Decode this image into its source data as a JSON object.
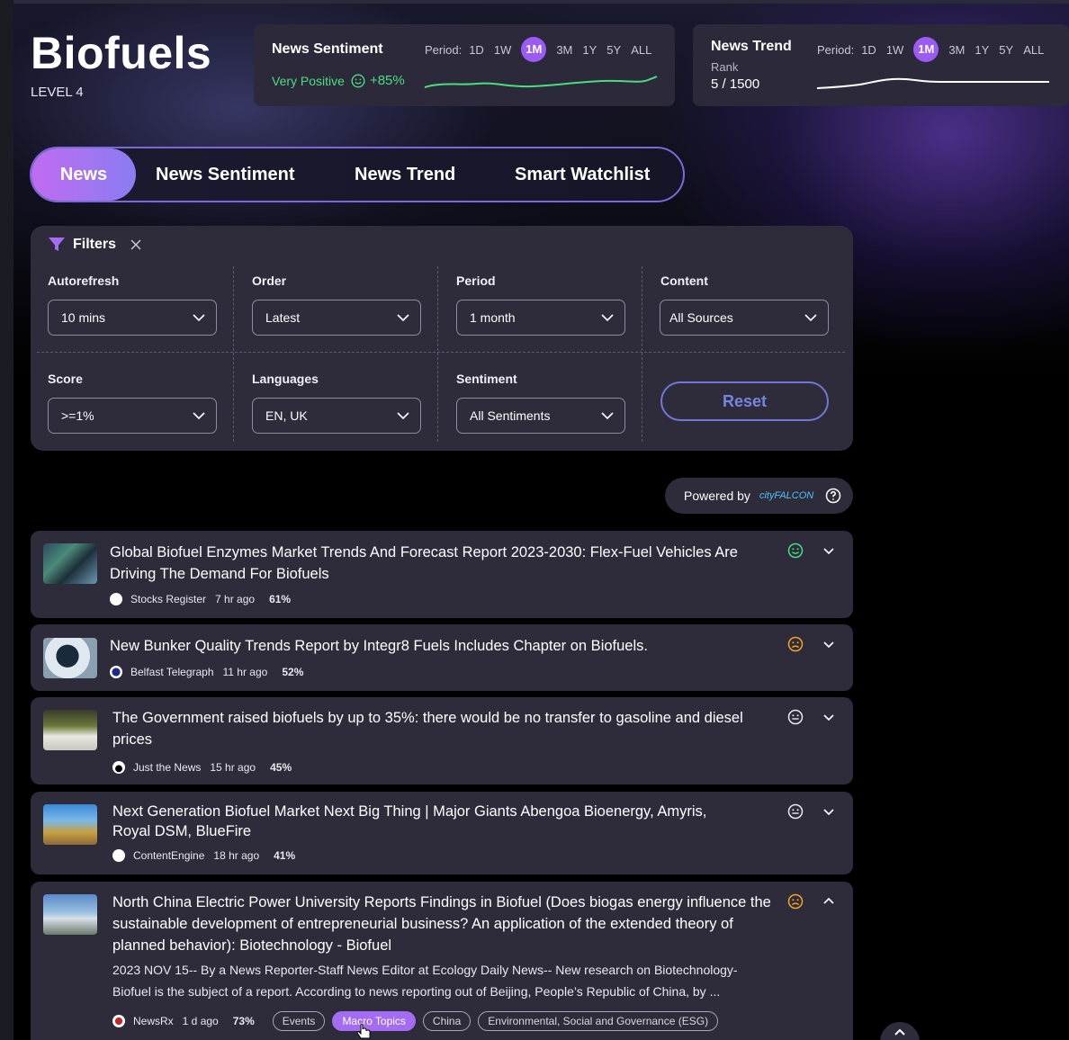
{
  "header": {
    "title": "Biofuels",
    "level": "LEVEL 4"
  },
  "sentiment_card": {
    "title": "News Sentiment",
    "status": "Very Positive",
    "value": "+85%",
    "period_label": "Period:",
    "periods": [
      "1D",
      "1W",
      "1M",
      "3M",
      "1Y",
      "5Y",
      "ALL"
    ],
    "active_period": "1M",
    "line_color": "#4ade80"
  },
  "trend_card": {
    "title": "News Trend",
    "rank_label": "Rank",
    "rank_value": "5 / 1500",
    "period_label": "Period:",
    "periods": [
      "1D",
      "1W",
      "1M",
      "3M",
      "1Y",
      "5Y",
      "ALL"
    ],
    "active_period": "1M"
  },
  "tabs": {
    "items": [
      "News",
      "News Sentiment",
      "News Trend",
      "Smart Watchlist"
    ],
    "active": "News"
  },
  "filters": {
    "title": "Filters",
    "autorefresh": {
      "label": "Autorefresh",
      "value": "10 mins"
    },
    "order": {
      "label": "Order",
      "value": "Latest"
    },
    "period": {
      "label": "Period",
      "value": "1 month"
    },
    "content": {
      "label": "Content",
      "value": "All Sources"
    },
    "score": {
      "label": "Score",
      "value": ">=1%"
    },
    "languages": {
      "label": "Languages",
      "value": "EN, UK"
    },
    "sentiment": {
      "label": "Sentiment",
      "value": "All Sentiments"
    },
    "reset_label": "Reset"
  },
  "powered": {
    "label": "Powered by",
    "logo_text": "cityFALCON"
  },
  "news": [
    {
      "title": "Global Biofuel Enzymes Market Trends And Forecast Report 2023-2030: Flex-Fuel Vehicles Are Driving The Demand For Biofuels",
      "source": "Stocks Register",
      "time": "7 hr ago",
      "score": "61%",
      "sentiment": "positive",
      "sentiment_color": "#4ade80"
    },
    {
      "title": "New Bunker Quality Trends Report by Integr8 Fuels Includes Chapter on Biofuels.",
      "source": "Belfast Telegraph",
      "time": "11 hr ago",
      "score": "52%",
      "sentiment": "negative",
      "sentiment_color": "#f5a524"
    },
    {
      "title": "The Government raised biofuels by up to 35%: there would be no transfer to gasoline and diesel prices",
      "source": "Just the News",
      "time": "15 hr ago",
      "score": "45%",
      "sentiment": "neutral",
      "sentiment_color": "#e8e8ee"
    },
    {
      "title": "Next Generation Biofuel Market Next Big Thing | Major Giants Abengoa Bioenergy, Amyris, Royal DSM, BlueFire",
      "source": "ContentEngine",
      "time": "18 hr ago",
      "score": "41%",
      "sentiment": "neutral",
      "sentiment_color": "#e8e8ee"
    },
    {
      "title": "North China Electric Power University Reports Findings in Biofuel (Does biogas energy influence the sustainable development of entrepreneurial business? An application of the extended theory of planned behavior): Biotechnology - Biofuel",
      "description": "2023 NOV 15-- By a News Reporter-Staff News Editor at Ecology Daily News-- New research on Biotechnology-Biofuel is the subject of a report. According to news reporting out of Beijing, People’s Republic of China, by ...",
      "source": "NewsRx",
      "time": "1 d ago",
      "score": "73%",
      "sentiment": "negative",
      "sentiment_color": "#f5a524",
      "tags": [
        "Events",
        "Macro Topics",
        "China",
        "Environmental, Social and Governance (ESG)"
      ],
      "active_tag": "Macro Topics"
    }
  ]
}
